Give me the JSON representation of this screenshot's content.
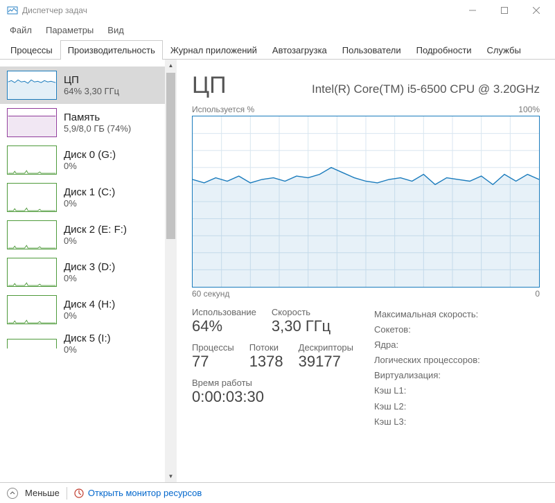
{
  "window": {
    "title": "Диспетчер задач"
  },
  "menu": {
    "file": "Файл",
    "options": "Параметры",
    "view": "Вид"
  },
  "tabs": {
    "processes": "Процессы",
    "performance": "Производительность",
    "apphistory": "Журнал приложений",
    "startup": "Автозагрузка",
    "users": "Пользователи",
    "details": "Подробности",
    "services": "Службы"
  },
  "sidebar": [
    {
      "label": "ЦП",
      "sub": "64%  3,30 ГГц",
      "kind": "cpu",
      "selected": true
    },
    {
      "label": "Память",
      "sub": "5,9/8,0 ГБ (74%)",
      "kind": "mem"
    },
    {
      "label": "Диск 0 (G:)",
      "sub": "0%",
      "kind": "disk"
    },
    {
      "label": "Диск 1 (C:)",
      "sub": "0%",
      "kind": "disk"
    },
    {
      "label": "Диск 2 (E: F:)",
      "sub": "0%",
      "kind": "disk"
    },
    {
      "label": "Диск 3 (D:)",
      "sub": "0%",
      "kind": "disk"
    },
    {
      "label": "Диск 4 (H:)",
      "sub": "0%",
      "kind": "disk"
    },
    {
      "label": "Диск 5 (I:)",
      "sub": "0%",
      "kind": "disk-partial"
    }
  ],
  "detail": {
    "title": "ЦП",
    "subtitle": "Intel(R) Core(TM) i5-6500 CPU @ 3.20GHz",
    "graphTopLeft": "Используется %",
    "graphTopRight": "100%",
    "axisLeft": "60 секунд",
    "axisRight": "0",
    "usageLabel": "Использование",
    "usageValue": "64%",
    "speedLabel": "Скорость",
    "speedValue": "3,30 ГГц",
    "processesLabel": "Процессы",
    "processesValue": "77",
    "threadsLabel": "Потоки",
    "threadsValue": "1378",
    "handlesLabel": "Дескрипторы",
    "handlesValue": "39177",
    "uptimeLabel": "Время работы",
    "uptimeValue": "0:00:03:30",
    "info": {
      "maxSpeed": "Максимальная скорость:",
      "sockets": "Сокетов:",
      "cores": "Ядра:",
      "logical": "Логических процессоров:",
      "virt": "Виртуализация:",
      "l1": "Кэш L1:",
      "l2": "Кэш L2:",
      "l3": "Кэш L3:"
    }
  },
  "bottom": {
    "less": "Меньше",
    "resmon": "Открыть монитор ресурсов"
  },
  "colors": {
    "cpu": "#187abc",
    "mem": "#8f3a9a",
    "disk": "#4e9a3a"
  },
  "chart_data": {
    "type": "line",
    "title": "Используется %",
    "xlabel": "60 секунд → 0",
    "ylabel": "%",
    "ylim": [
      0,
      100
    ],
    "x": [
      60,
      58,
      56,
      54,
      52,
      50,
      48,
      46,
      44,
      42,
      40,
      38,
      36,
      34,
      32,
      30,
      28,
      26,
      24,
      22,
      20,
      18,
      16,
      14,
      12,
      10,
      8,
      6,
      4,
      2,
      0
    ],
    "values": [
      63,
      61,
      64,
      62,
      65,
      61,
      63,
      64,
      62,
      65,
      64,
      66,
      70,
      67,
      64,
      62,
      61,
      63,
      64,
      62,
      66,
      60,
      64,
      63,
      62,
      65,
      60,
      66,
      62,
      66,
      63
    ]
  }
}
